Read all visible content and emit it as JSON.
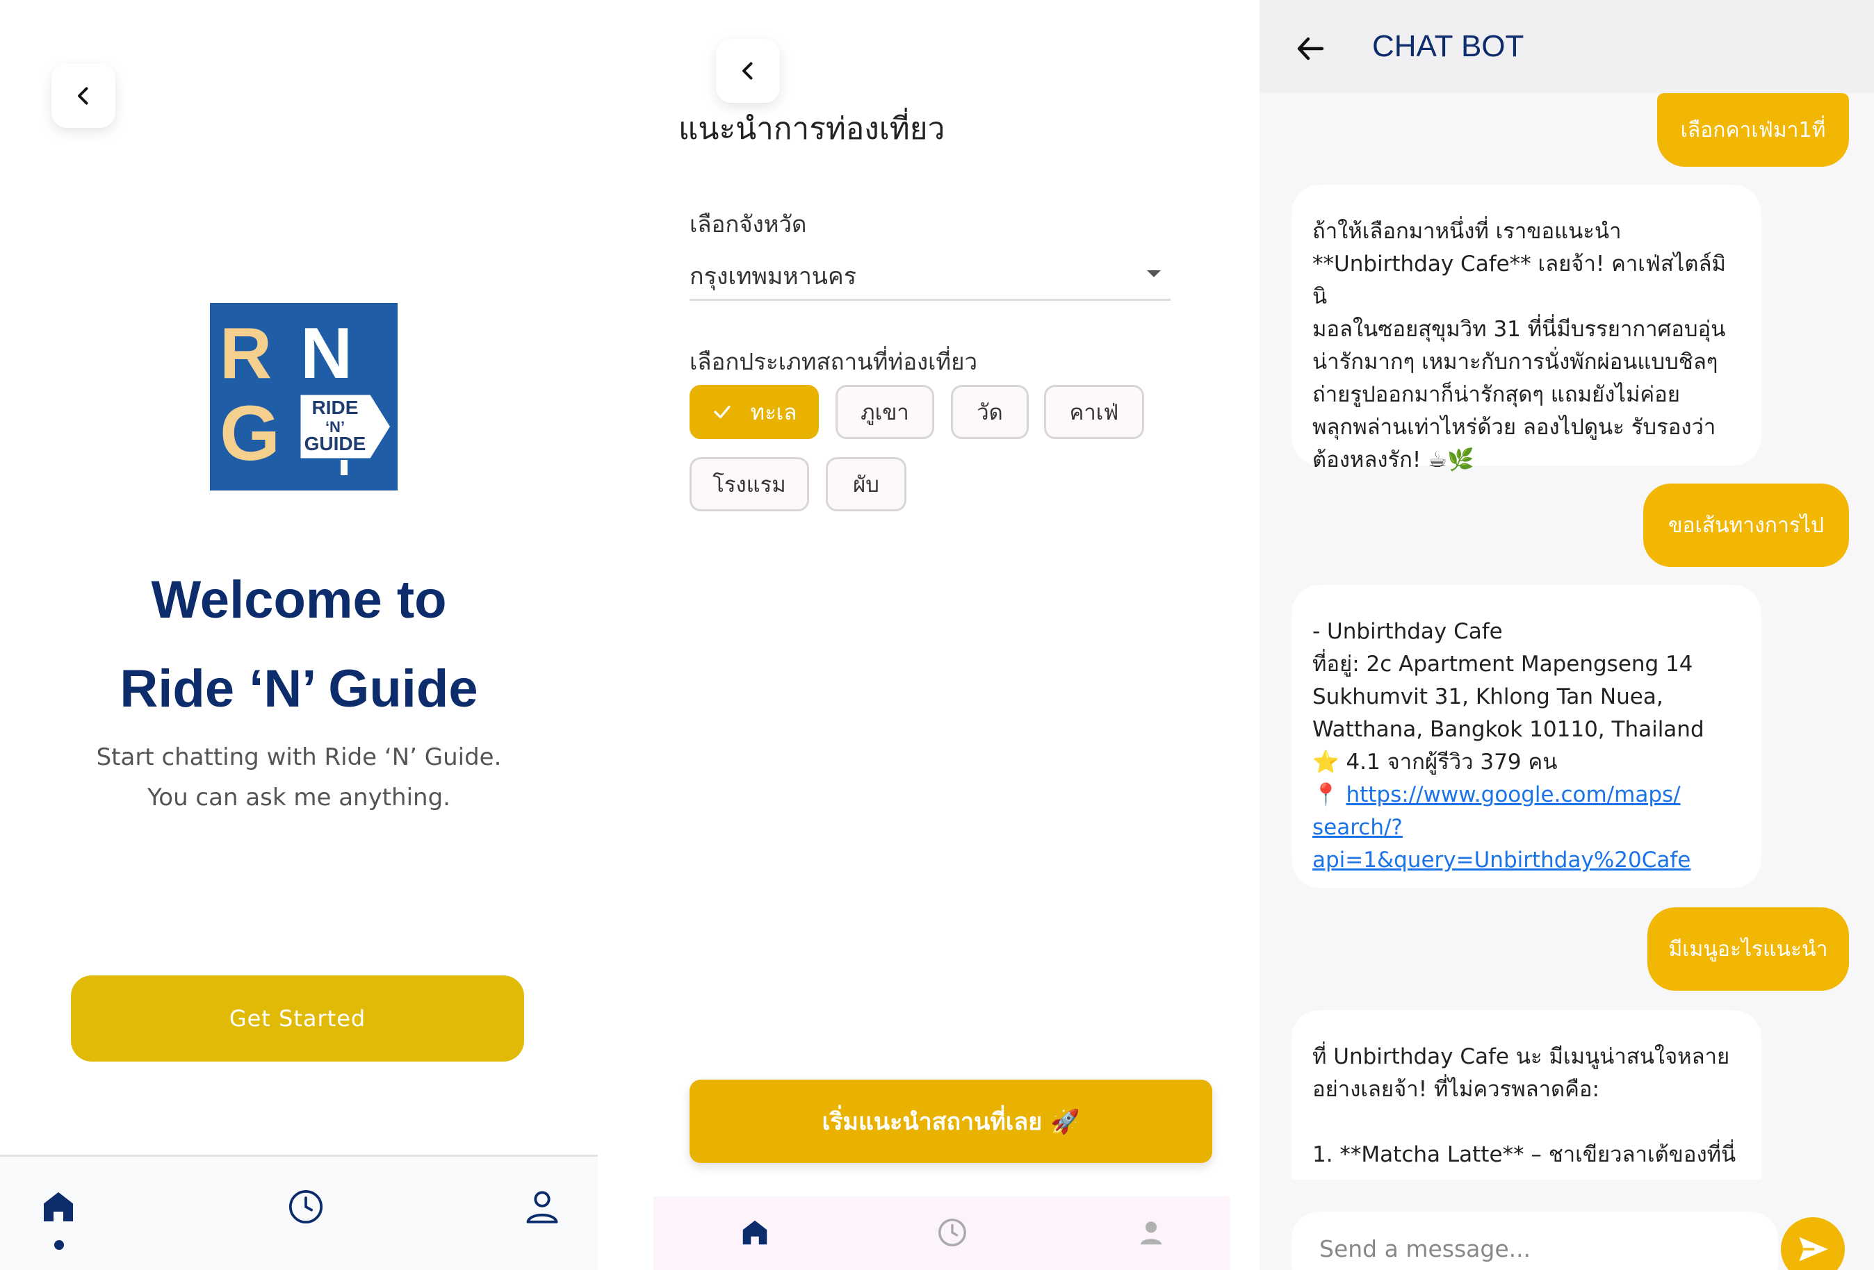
{
  "welcome_screen": {
    "welcome_line1": "Welcome to",
    "welcome_line2": "Ride ‘N’ Guide",
    "subtitle_line1": "Start chatting with Ride ‘N’ Guide.",
    "subtitle_line2": "You can ask me anything.",
    "get_started_label": "Get Started",
    "logo_text": {
      "r": "R",
      "n": "N",
      "g": "G",
      "ride": "RIDE",
      "n_mark": "‘N’",
      "guide": "GUIDE"
    },
    "nav": [
      {
        "icon": "home-icon",
        "active": true
      },
      {
        "icon": "clock-icon",
        "active": false
      },
      {
        "icon": "profile-icon",
        "active": false
      }
    ]
  },
  "recommend_screen": {
    "title": "แนะนำการท่องเที่ยว",
    "province_label": "เลือกจังหวัด",
    "province_value": "กรุงเทพมหานคร",
    "type_label": "เลือกประเภทสถานที่ท่องเที่ยว",
    "chips": [
      {
        "label": "ทะเล",
        "selected": true
      },
      {
        "label": "ภูเขา",
        "selected": false
      },
      {
        "label": "วัด",
        "selected": false
      },
      {
        "label": "คาเฟ่",
        "selected": false
      },
      {
        "label": "โรงแรม",
        "selected": false
      },
      {
        "label": "ผับ",
        "selected": false
      }
    ],
    "start_button_label": "เริ่มแนะนำสถานที่เลย 🚀"
  },
  "chat_screen": {
    "title": "CHAT BOT",
    "messages": [
      {
        "sender": "user",
        "text": "เลือกคาเฟ่มา1ที่"
      },
      {
        "sender": "bot",
        "text": "ถ้าให้เลือกมาหนึ่งที่ เราขอแนะนำ\n**Unbirthday Cafe** เลยจ้า! คาเฟ่สไตล์มินิ\nมอลในซอยสุขุมวิท 31 ที่นี่มีบรรยากาศอบอุ่น\nน่ารักมากๆ เหมาะกับการนั่งพักผ่อนแบบชิลๆ\nถ่ายรูปออกมาก็น่ารักสุดๆ แถมยังไม่ค่อย\nพลุกพล่านเท่าไหร่ด้วย ลองไปดูนะ รับรองว่า\nต้องหลงรัก! ☕🌿"
      },
      {
        "sender": "user",
        "text": "ขอเส้นทางการไป"
      },
      {
        "sender": "bot",
        "text": "- Unbirthday Cafe\nที่อยู่: 2c Apartment Mapengseng 14\nSukhumvit 31, Khlong Tan Nuea,\nWatthana, Bangkok 10110, Thailand\n⭐ 4.1 จากผู้รีวิว 379 คน",
        "link_prefix": "📍 ",
        "link": "https://www.google.com/maps/\nsearch/?api=1&query=Unbirthday%20Cafe"
      },
      {
        "sender": "user",
        "text": "มีเมนูอะไรแนะนำ"
      },
      {
        "sender": "bot",
        "text": "ที่ Unbirthday Cafe นะ มีเมนูน่าสนใจหลาย\nอย่างเลยจ้า! ที่ไม่ควรพลาดคือ:\n\n1. **Matcha Latte** – ชาเขียวลาเต้ของที่นี่"
      }
    ],
    "input_placeholder": "Send a message..."
  },
  "colors": {
    "brand_navy": "#0d2c6b",
    "accent_yellow": "#e0ba07",
    "chat_yellow": "#f2b705"
  }
}
